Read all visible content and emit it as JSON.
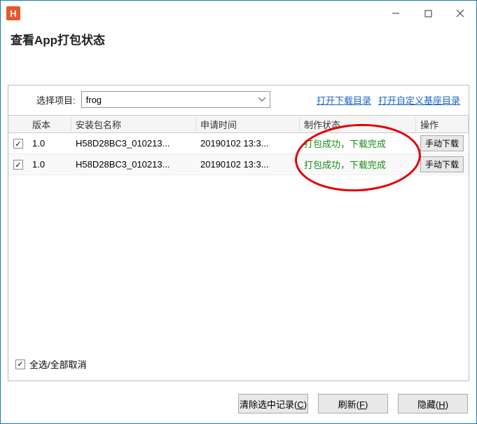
{
  "window": {
    "logo_letter": "H",
    "title": "查看App打包状态"
  },
  "top": {
    "select_label": "选择项目:",
    "selected_project": "frog",
    "link_download_dir": "打开下载目录",
    "link_custom_base_dir": "打开自定义基座目录"
  },
  "table": {
    "headers": {
      "version": "版本",
      "package": "安装包名称",
      "time": "申请时间",
      "status": "制作状态",
      "op": "操作"
    },
    "rows": [
      {
        "checked": true,
        "version": "1.0",
        "package": "H58D28BC3_010213...",
        "time": "20190102 13:3...",
        "status": "打包成功，下载完成",
        "op_label": "手动下载"
      },
      {
        "checked": true,
        "version": "1.0",
        "package": "H58D28BC3_010213...",
        "time": "20190102 13:3...",
        "status": "打包成功，下载完成",
        "op_label": "手动下载"
      }
    ]
  },
  "select_all_label": "全选/全部取消",
  "buttons": {
    "clear": {
      "prefix": "清除选中记录(",
      "key": "C",
      "suffix": ")"
    },
    "refresh": {
      "prefix": "刷新(",
      "key": "F",
      "suffix": ")"
    },
    "hide": {
      "prefix": "隐藏(",
      "key": "H",
      "suffix": ")"
    }
  }
}
